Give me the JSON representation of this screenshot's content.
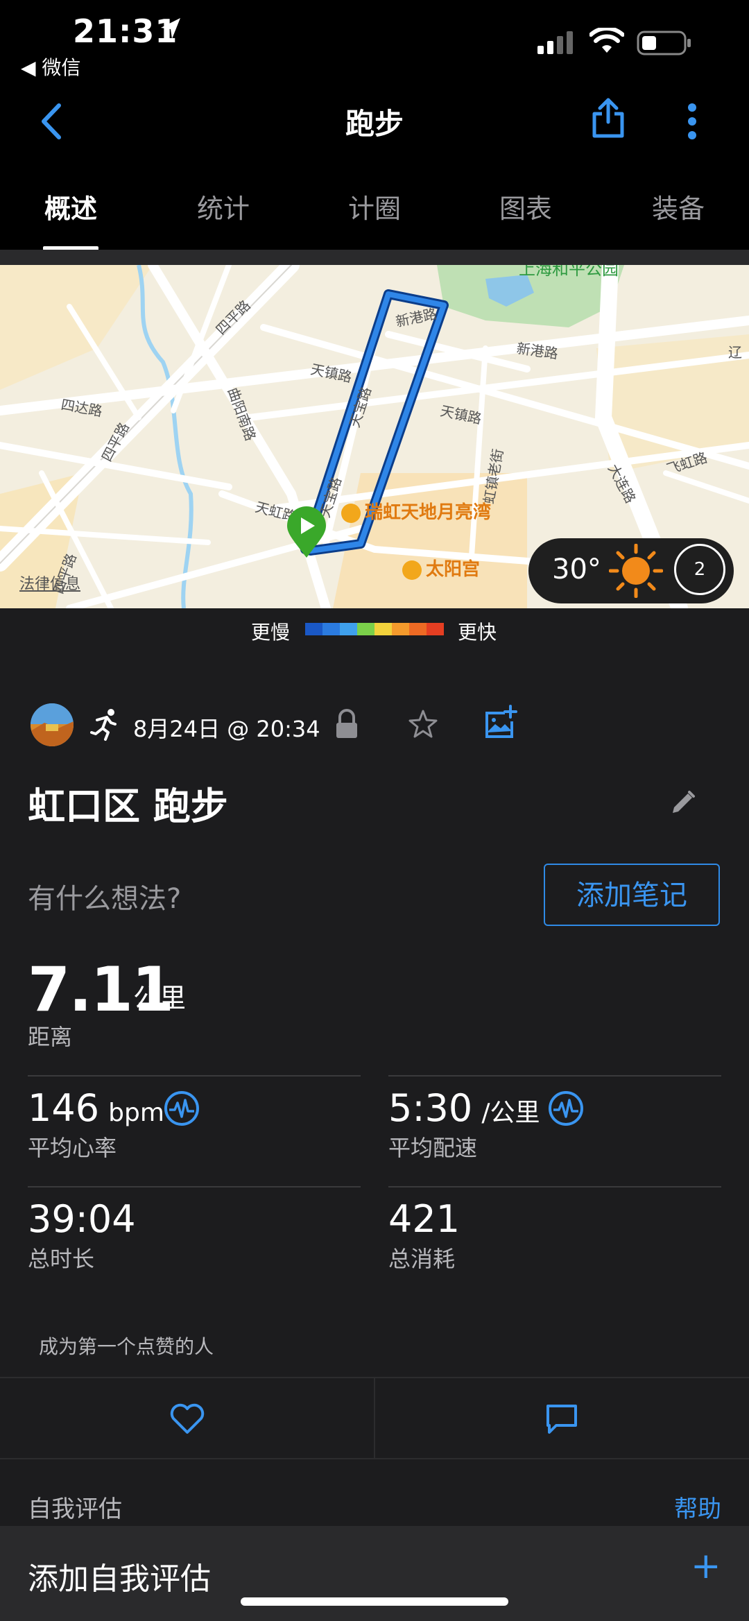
{
  "status_bar": {
    "time": "21:31",
    "back_app": "◀ 微信"
  },
  "header": {
    "title": "跑步"
  },
  "tabs": [
    {
      "label": "概述"
    },
    {
      "label": "统计"
    },
    {
      "label": "计圈"
    },
    {
      "label": "图表"
    },
    {
      "label": "装备"
    }
  ],
  "map": {
    "roads": [
      "新港路",
      "新港路",
      "天镇路",
      "天镇路",
      "天宝路",
      "四平路",
      "四平路",
      "四达路",
      "四平路",
      "曲阳南路",
      "天虹路",
      "天宝路",
      "虹镇老街",
      "大连路",
      "飞虹路",
      "辽"
    ],
    "pois": [
      {
        "name": "瑞虹天地月亮湾"
      },
      {
        "name": "太阳宫"
      }
    ],
    "park": "上海和平公园",
    "legal": "法律信息",
    "weather": {
      "temp": "30°",
      "wind": "2"
    },
    "legend": {
      "slower": "更慢",
      "faster": "更快",
      "colors": [
        "#1a58c6",
        "#2b7be0",
        "#3fa0ec",
        "#7bd04a",
        "#f2d23c",
        "#f49a2c",
        "#ee6a24",
        "#e53e22"
      ]
    }
  },
  "activity": {
    "date": "8月24日 @ 20:34",
    "title": "虹口区 跑步",
    "thoughts_prompt": "有什么想法?",
    "add_note": "添加笔记",
    "distance": {
      "value": "7.11",
      "unit": "公里",
      "label": "距离"
    },
    "avg_hr": {
      "value": "146",
      "unit": "bpm",
      "label": "平均心率"
    },
    "avg_pace": {
      "value": "5:30",
      "unit": "/公里",
      "label": "平均配速"
    },
    "total_time": {
      "value": "39:04",
      "label": "总时长"
    },
    "calories": {
      "value": "421",
      "label": "总消耗"
    },
    "likes": "成为第一个点赞的人"
  },
  "self_eval": {
    "title": "自我评估",
    "help": "帮助",
    "add": "添加自我评估",
    "plus": "+"
  },
  "colors": {
    "accent": "#3a95f0",
    "route": "#1f6fd6"
  }
}
